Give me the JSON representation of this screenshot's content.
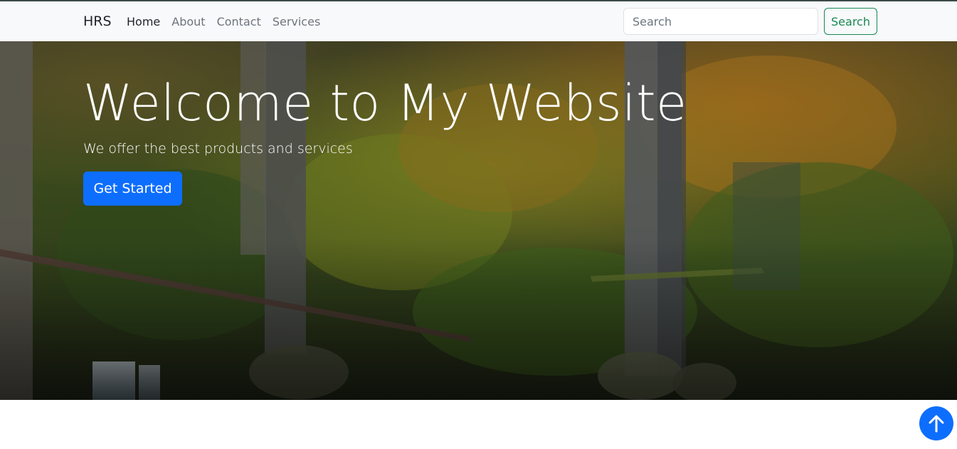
{
  "nav": {
    "brand": "HRS",
    "links": [
      {
        "label": "Home",
        "active": true
      },
      {
        "label": "About",
        "active": false
      },
      {
        "label": "Contact",
        "active": false
      },
      {
        "label": "Services",
        "active": false
      }
    ],
    "search": {
      "placeholder": "Search",
      "value": "",
      "button_label": "Search"
    }
  },
  "hero": {
    "title": "Welcome to My Website",
    "subtitle": "We offer the best products and services",
    "cta_label": "Get Started"
  },
  "scroll_top": {
    "icon": "arrow-up-icon"
  },
  "colors": {
    "primary": "#0d6efd",
    "success": "#198754",
    "navbar_bg": "#f8f9fa"
  }
}
